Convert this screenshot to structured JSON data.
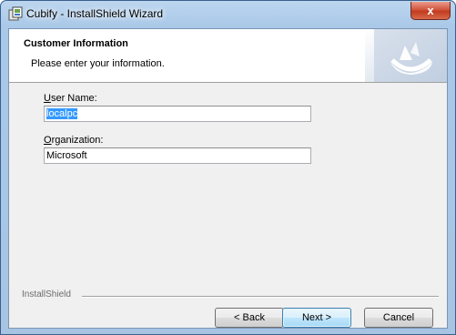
{
  "window": {
    "title": "Cubify - InstallShield Wizard",
    "close_glyph": "x"
  },
  "header": {
    "title": "Customer Information",
    "subtitle": "Please enter your information."
  },
  "form": {
    "user_name": {
      "label_access_key": "U",
      "label_rest": "ser Name:",
      "value": "localpc"
    },
    "organization": {
      "label_access_key": "O",
      "label_rest": "rganization:",
      "value": "Microsoft"
    }
  },
  "footer": {
    "brand": "InstallShield",
    "back_label": "< Back",
    "next_label": "Next >",
    "cancel_label": "Cancel"
  },
  "colors": {
    "selection": "#3399ff",
    "close_button": "#c23b1f",
    "default_button_border": "#3c7fb1"
  },
  "icons": [
    "installer-app-icon",
    "close-icon",
    "installshield-logo"
  ]
}
